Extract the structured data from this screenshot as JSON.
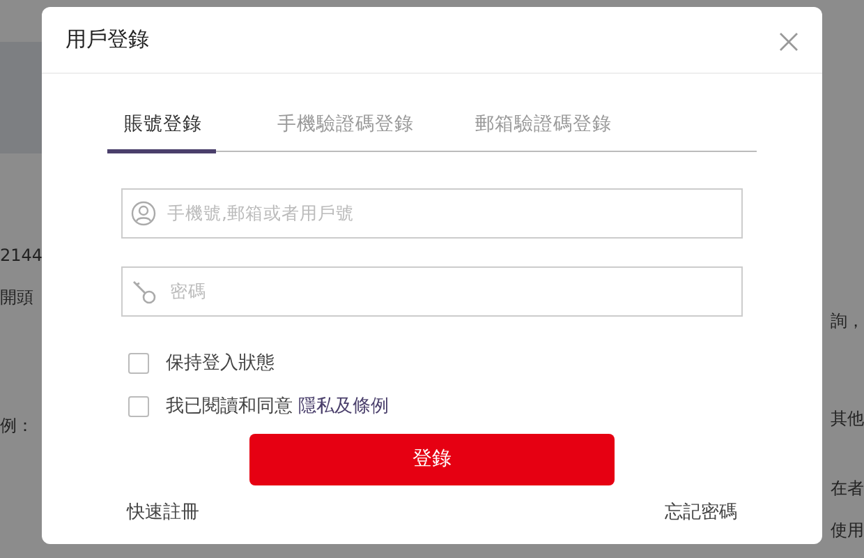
{
  "background_page": {
    "left_texts": [
      "2144",
      "開頭",
      "例："
    ],
    "right_texts": [
      "詢，",
      "其他",
      "在者",
      "使用"
    ]
  },
  "dialog": {
    "title": "用戶登錄",
    "tabs": [
      {
        "label": "賬號登錄",
        "selected": true
      },
      {
        "label": "手機驗證碼登錄",
        "selected": false
      },
      {
        "label": "郵箱驗證碼登錄",
        "selected": false
      }
    ],
    "fields": [
      {
        "kind": "user",
        "placeholder": "手機號,郵箱或者用戶號"
      },
      {
        "kind": "password",
        "placeholder": "密碼"
      }
    ],
    "checkboxes": [
      {
        "label": "保持登入狀態",
        "checked": false
      },
      {
        "label": "我已閱讀和同意",
        "link": "隱私及條例",
        "checked": false
      }
    ],
    "submit": "登錄",
    "footer_links": [
      "快速註冊",
      "忘記密碼"
    ]
  }
}
